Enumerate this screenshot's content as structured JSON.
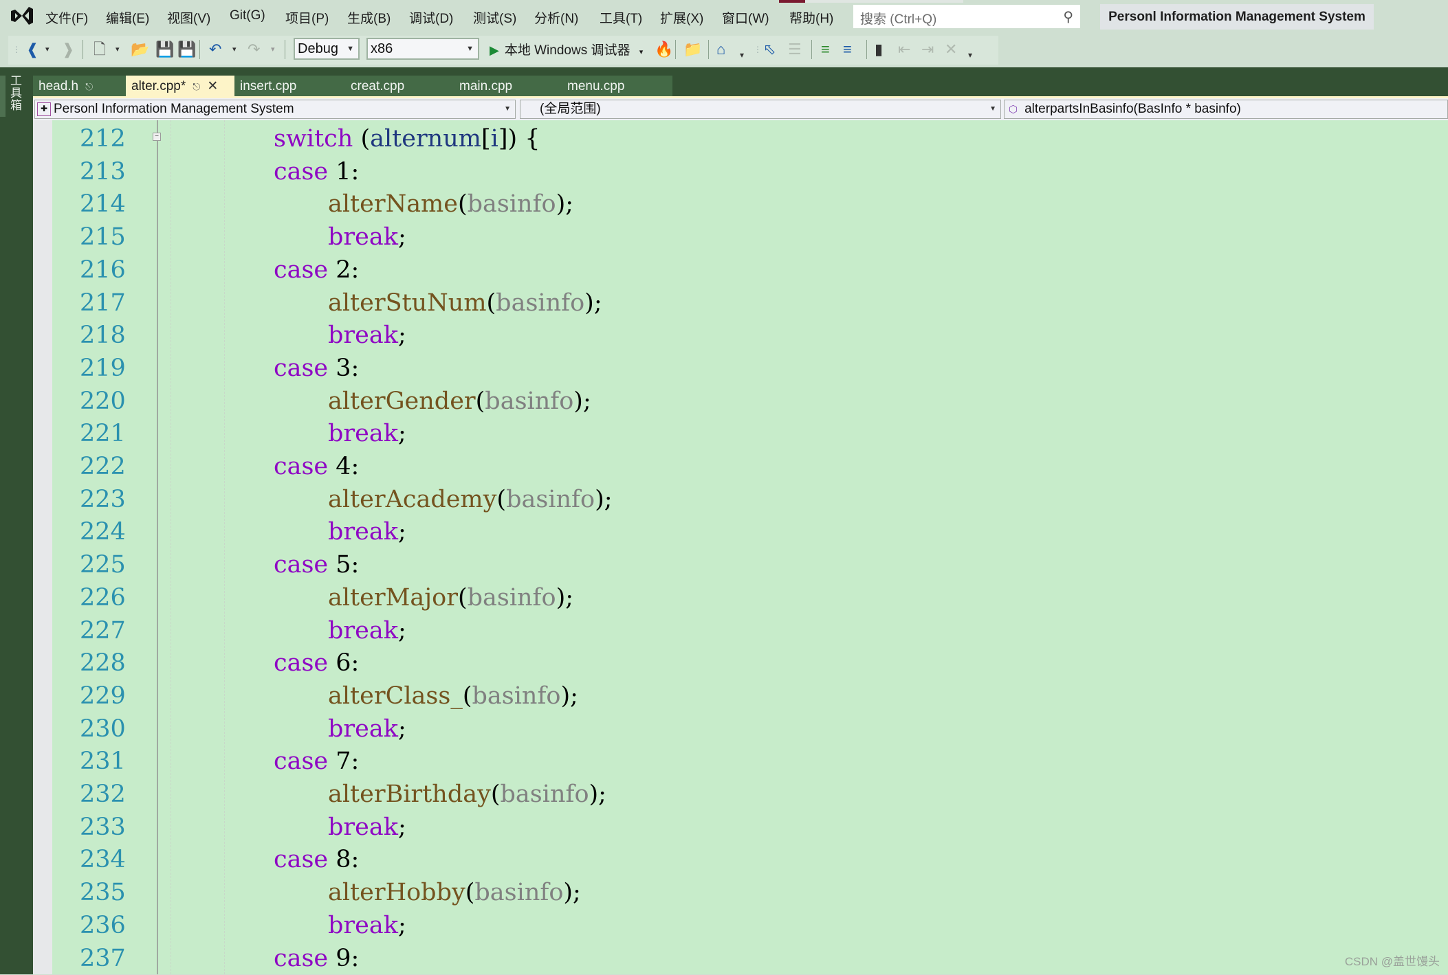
{
  "app": {
    "solution_title": "Personl Information Management System",
    "menu": [
      "文件(F)",
      "编辑(E)",
      "视图(V)",
      "Git(G)",
      "项目(P)",
      "生成(B)",
      "调试(D)",
      "测试(S)",
      "分析(N)",
      "工具(T)",
      "扩展(X)",
      "窗口(W)",
      "帮助(H)"
    ],
    "search": {
      "placeholder": "搜索 (Ctrl+Q)",
      "value": ""
    }
  },
  "toolbar": {
    "configuration": "Debug",
    "platform": "x86",
    "run_label": "本地 Windows 调试器",
    "icons": [
      "back-icon",
      "forward-icon",
      "new-item-icon",
      "open-file-icon",
      "save-icon",
      "save-all-icon",
      "undo-icon",
      "redo-icon",
      "hot-reload-icon",
      "find-in-files-icon",
      "home-icon",
      "select-icon",
      "comment-block-icon",
      "indent-icon",
      "outdent-icon",
      "bookmark-icon",
      "prev-bookmark-icon",
      "next-bookmark-icon",
      "clear-bookmarks-icon"
    ]
  },
  "toolbox": {
    "label": "工具箱"
  },
  "tabs": [
    {
      "label": "head.h",
      "pinned": true,
      "active": false
    },
    {
      "label": "alter.cpp*",
      "pinned": true,
      "active": true
    },
    {
      "label": "insert.cpp",
      "active": false
    },
    {
      "label": "creat.cpp",
      "active": false
    },
    {
      "label": "main.cpp",
      "active": false
    },
    {
      "label": "menu.cpp",
      "active": false
    }
  ],
  "navbar": {
    "project": "Personl Information Management System",
    "scope": "(全局范围)",
    "member": "alterpartsInBasinfo(BasInfo * basinfo)"
  },
  "editor": {
    "lines": [
      {
        "num": "212",
        "indent": 2,
        "tokens": [
          {
            "t": "switch",
            "c": "kw"
          },
          {
            "t": " (",
            "c": "punc"
          },
          {
            "t": "alternum",
            "c": "var"
          },
          {
            "t": "[",
            "c": "punc"
          },
          {
            "t": "i",
            "c": "var"
          },
          {
            "t": "]) {",
            "c": "punc"
          }
        ]
      },
      {
        "num": "213",
        "indent": 2,
        "tokens": [
          {
            "t": "case",
            "c": "kw"
          },
          {
            "t": " 1:",
            "c": "num"
          }
        ]
      },
      {
        "num": "214",
        "indent": 3,
        "tokens": [
          {
            "t": "alterName",
            "c": "fn"
          },
          {
            "t": "(",
            "c": "punc"
          },
          {
            "t": "basinfo",
            "c": "param"
          },
          {
            "t": ");",
            "c": "punc"
          }
        ]
      },
      {
        "num": "215",
        "indent": 3,
        "tokens": [
          {
            "t": "break",
            "c": "kw"
          },
          {
            "t": ";",
            "c": "punc"
          }
        ]
      },
      {
        "num": "216",
        "indent": 2,
        "tokens": [
          {
            "t": "case",
            "c": "kw"
          },
          {
            "t": " 2:",
            "c": "num"
          }
        ]
      },
      {
        "num": "217",
        "indent": 3,
        "tokens": [
          {
            "t": "alterStuNum",
            "c": "fn"
          },
          {
            "t": "(",
            "c": "punc"
          },
          {
            "t": "basinfo",
            "c": "param"
          },
          {
            "t": ");",
            "c": "punc"
          }
        ]
      },
      {
        "num": "218",
        "indent": 3,
        "tokens": [
          {
            "t": "break",
            "c": "kw"
          },
          {
            "t": ";",
            "c": "punc"
          }
        ]
      },
      {
        "num": "219",
        "indent": 2,
        "tokens": [
          {
            "t": "case",
            "c": "kw"
          },
          {
            "t": " 3:",
            "c": "num"
          }
        ]
      },
      {
        "num": "220",
        "indent": 3,
        "tokens": [
          {
            "t": "alterGender",
            "c": "fn"
          },
          {
            "t": "(",
            "c": "punc"
          },
          {
            "t": "basinfo",
            "c": "param"
          },
          {
            "t": ");",
            "c": "punc"
          }
        ]
      },
      {
        "num": "221",
        "indent": 3,
        "tokens": [
          {
            "t": "break",
            "c": "kw"
          },
          {
            "t": ";",
            "c": "punc"
          }
        ]
      },
      {
        "num": "222",
        "indent": 2,
        "tokens": [
          {
            "t": "case",
            "c": "kw"
          },
          {
            "t": " 4:",
            "c": "num"
          }
        ]
      },
      {
        "num": "223",
        "indent": 3,
        "tokens": [
          {
            "t": "alterAcademy",
            "c": "fn"
          },
          {
            "t": "(",
            "c": "punc"
          },
          {
            "t": "basinfo",
            "c": "param"
          },
          {
            "t": ");",
            "c": "punc"
          }
        ]
      },
      {
        "num": "224",
        "indent": 3,
        "tokens": [
          {
            "t": "break",
            "c": "kw"
          },
          {
            "t": ";",
            "c": "punc"
          }
        ]
      },
      {
        "num": "225",
        "indent": 2,
        "tokens": [
          {
            "t": "case",
            "c": "kw"
          },
          {
            "t": " 5:",
            "c": "num"
          }
        ]
      },
      {
        "num": "226",
        "indent": 3,
        "tokens": [
          {
            "t": "alterMajor",
            "c": "fn"
          },
          {
            "t": "(",
            "c": "punc"
          },
          {
            "t": "basinfo",
            "c": "param"
          },
          {
            "t": ");",
            "c": "punc"
          }
        ]
      },
      {
        "num": "227",
        "indent": 3,
        "tokens": [
          {
            "t": "break",
            "c": "kw"
          },
          {
            "t": ";",
            "c": "punc"
          }
        ]
      },
      {
        "num": "228",
        "indent": 2,
        "tokens": [
          {
            "t": "case",
            "c": "kw"
          },
          {
            "t": " 6:",
            "c": "num"
          }
        ]
      },
      {
        "num": "229",
        "indent": 3,
        "tokens": [
          {
            "t": "alterClass_",
            "c": "fn"
          },
          {
            "t": "(",
            "c": "punc"
          },
          {
            "t": "basinfo",
            "c": "param"
          },
          {
            "t": ");",
            "c": "punc"
          }
        ]
      },
      {
        "num": "230",
        "indent": 3,
        "tokens": [
          {
            "t": "break",
            "c": "kw"
          },
          {
            "t": ";",
            "c": "punc"
          }
        ]
      },
      {
        "num": "231",
        "indent": 2,
        "tokens": [
          {
            "t": "case",
            "c": "kw"
          },
          {
            "t": " 7:",
            "c": "num"
          }
        ]
      },
      {
        "num": "232",
        "indent": 3,
        "tokens": [
          {
            "t": "alterBirthday",
            "c": "fn"
          },
          {
            "t": "(",
            "c": "punc"
          },
          {
            "t": "basinfo",
            "c": "param"
          },
          {
            "t": ");",
            "c": "punc"
          }
        ]
      },
      {
        "num": "233",
        "indent": 3,
        "tokens": [
          {
            "t": "break",
            "c": "kw"
          },
          {
            "t": ";",
            "c": "punc"
          }
        ]
      },
      {
        "num": "234",
        "indent": 2,
        "tokens": [
          {
            "t": "case",
            "c": "kw"
          },
          {
            "t": " 8:",
            "c": "num"
          }
        ]
      },
      {
        "num": "235",
        "indent": 3,
        "tokens": [
          {
            "t": "alterHobby",
            "c": "fn"
          },
          {
            "t": "(",
            "c": "punc"
          },
          {
            "t": "basinfo",
            "c": "param"
          },
          {
            "t": ");",
            "c": "punc"
          }
        ]
      },
      {
        "num": "236",
        "indent": 3,
        "tokens": [
          {
            "t": "break",
            "c": "kw"
          },
          {
            "t": ";",
            "c": "punc"
          }
        ]
      },
      {
        "num": "237",
        "indent": 2,
        "tokens": [
          {
            "t": "case",
            "c": "kw"
          },
          {
            "t": " 9:",
            "c": "num"
          }
        ]
      }
    ]
  },
  "watermark": "CSDN @盖世馒头",
  "colors": {
    "editor_bg": "#c7ecca",
    "chrome_bg": "#cfdfd1",
    "dark_frame": "#335033",
    "keyword": "#8f08c4",
    "function": "#74531f",
    "parameter": "#808080",
    "variable": "#1f377f",
    "line_number": "#2b91af",
    "active_tab": "#fdf4c8"
  }
}
